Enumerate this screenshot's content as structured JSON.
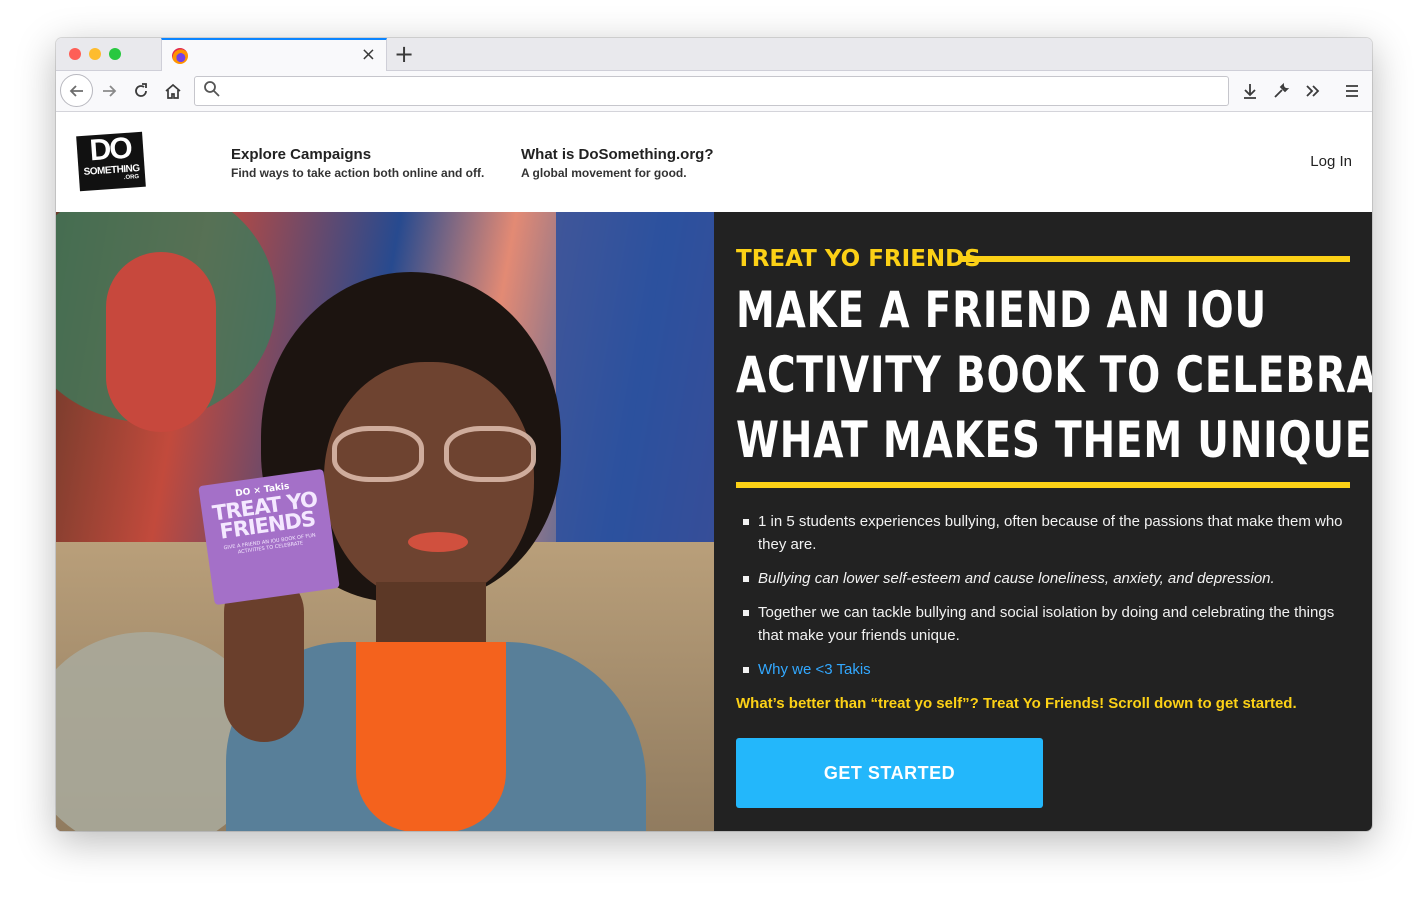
{
  "browser": {
    "tab_close_glyph": "×",
    "new_tab_glyph": "+",
    "url_value": "",
    "url_placeholder": "",
    "icons": [
      "back-arrow-icon",
      "forward-arrow-icon",
      "reload-icon",
      "home-icon",
      "search-icon",
      "download-icon",
      "wrench-icon",
      "overflow-chevron-icon",
      "hamburger-menu-icon"
    ]
  },
  "header": {
    "logo": {
      "line1": "DO",
      "line2": "SOMETHING",
      "line3": ".ORG"
    },
    "nav": [
      {
        "title": "Explore Campaigns",
        "subtitle": "Find ways to take action both online and off."
      },
      {
        "title": "What is DoSomething.org?",
        "subtitle": "A global movement for good."
      }
    ],
    "login": "Log In"
  },
  "hero": {
    "photo_card": {
      "top": "DO × Takis",
      "title": "TREAT YO FRIENDS",
      "small": "GIVE A FRIEND AN IOU BOOK OF FUN ACTIVITIES TO CELEBRATE"
    },
    "eyebrow": "TREAT YO FRIENDS",
    "headline": [
      "MAKE A FRIEND AN IOU",
      "ACTIVITY BOOK TO CELEBRATE",
      "WHAT MAKES THEM UNIQUE."
    ],
    "bullets": [
      "1 in 5 students experiences bullying, often because of the passions that make them who they are.",
      "Bullying can lower self-esteem and cause loneliness, anxiety, and depression.",
      "Together we can tackle bullying and social isolation by doing and celebrating the things that make your friends unique."
    ],
    "link": "Why we <3 Takis",
    "cta_text": "What’s better than “treat yo self”? Treat Yo Friends! Scroll down to get started.",
    "button": "GET STARTED"
  },
  "colors": {
    "accent_yellow": "#fcd116",
    "button_blue": "#23b7fb",
    "link_blue": "#32a8ff",
    "hero_bg": "#222222"
  }
}
